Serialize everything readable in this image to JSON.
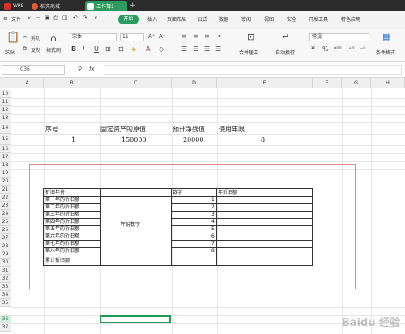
{
  "tabs": [
    {
      "label": "WPS"
    },
    {
      "label": "稻壳商城"
    },
    {
      "label": "工作簿1"
    }
  ],
  "menu": {
    "file": "文件",
    "items": [
      "开始",
      "插入",
      "页面布局",
      "公式",
      "数据",
      "审阅",
      "视图",
      "安全",
      "开发工具",
      "特色应用"
    ]
  },
  "ribbon": {
    "cut": "剪切",
    "copy": "复制",
    "paste": "粘贴",
    "format_painter": "格式刷",
    "font_name": "宋体",
    "font_size": "11",
    "merge_center": "合并居中",
    "auto_wrap": "自动换行",
    "number_format": "常规",
    "cond_format": "条件格式"
  },
  "formula": {
    "cell_ref": "C36",
    "fx": "fx"
  },
  "columns": [
    "A",
    "B",
    "C",
    "D",
    "E",
    "F",
    "G",
    "H"
  ],
  "rows": [
    "10",
    "11",
    "12",
    "13",
    "14",
    "15",
    "16",
    "17",
    "18",
    "19",
    "20",
    "21",
    "22",
    "23",
    "24",
    "25",
    "26",
    "27",
    "28",
    "29",
    "30",
    "31",
    "32",
    "33",
    "34",
    "35",
    "36",
    "37"
  ],
  "sheet": {
    "headers": {
      "seq": "序号",
      "asset": "固定资产的原值",
      "residual": "预计净残值",
      "life": "使用年限"
    },
    "values": {
      "seq": "1",
      "asset": "150000",
      "residual": "20000",
      "life": "8"
    }
  },
  "table": {
    "col1_header": "折旧年份",
    "col3_header": "数字",
    "col4_header": "年折旧额",
    "merged_label": "年份数字",
    "rows": [
      "第一年的折旧额",
      "第二年的折旧额",
      "第三年的折旧额",
      "第四年的折旧额",
      "第五年的折旧额",
      "第六年的折旧额",
      "第七年的折旧额",
      "第八年的折旧额"
    ],
    "numbers": [
      "1",
      "2",
      "3",
      "4",
      "5",
      "6",
      "7",
      "8"
    ],
    "total": "累计折旧额"
  },
  "watermark": "Baidu 经验"
}
